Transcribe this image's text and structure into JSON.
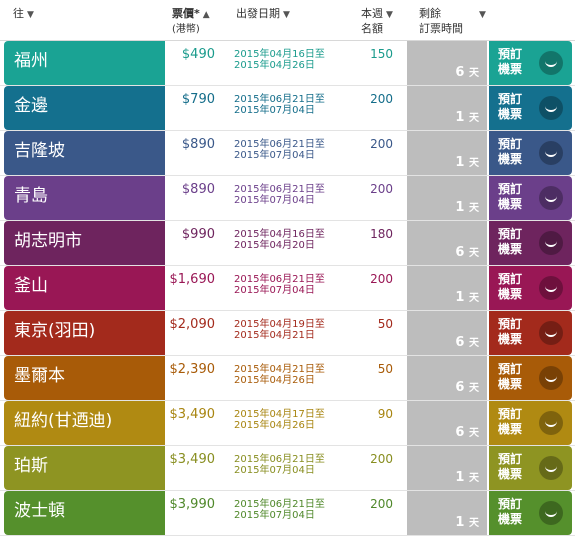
{
  "header": {
    "dest": "往",
    "price_line1": "票價*",
    "price_line2": "(港幣)",
    "price_sort": "▲",
    "date": "出發日期",
    "quota_line1": "本週",
    "quota_line2": "名額",
    "remain_line1": "剩餘",
    "remain_line2": "訂票時間",
    "sort_arrow": "▼"
  },
  "book_label_line1": "預訂",
  "book_label_line2": "機票",
  "days_unit": "天",
  "rows": [
    {
      "dest": "福州",
      "price": "$490",
      "date1": "2015年04月16日至",
      "date2": "2015年04月26日",
      "quota": "150",
      "days": "6",
      "color": "#1aa394",
      "text": "#1a9b8c"
    },
    {
      "dest": "金邊",
      "price": "$790",
      "date1": "2015年06月21日至",
      "date2": "2015年07月04日",
      "quota": "200",
      "days": "1",
      "color": "#14708e",
      "text": "#146d8a"
    },
    {
      "dest": "吉隆坡",
      "price": "$890",
      "date1": "2015年06月21日至",
      "date2": "2015年07月04日",
      "quota": "200",
      "days": "1",
      "color": "#3a5889",
      "text": "#3a5889"
    },
    {
      "dest": "青島",
      "price": "$890",
      "date1": "2015年06月21日至",
      "date2": "2015年07月04日",
      "quota": "200",
      "days": "1",
      "color": "#6b3f8a",
      "text": "#6b3f8a"
    },
    {
      "dest": "胡志明市",
      "price": "$990",
      "date1": "2015年04月16日至",
      "date2": "2015年04月20日",
      "quota": "180",
      "days": "6",
      "color": "#6e245e",
      "text": "#6e245e"
    },
    {
      "dest": "釜山",
      "price": "$1,690",
      "date1": "2015年06月21日至",
      "date2": "2015年07月04日",
      "quota": "200",
      "days": "1",
      "color": "#991755",
      "text": "#991755"
    },
    {
      "dest": "東京(羽田)",
      "price": "$2,090",
      "date1": "2015年04月19日至",
      "date2": "2015年04月21日",
      "quota": "50",
      "days": "6",
      "color": "#a32a1c",
      "text": "#a32a1c"
    },
    {
      "dest": "墨爾本",
      "price": "$2,390",
      "date1": "2015年04月21日至",
      "date2": "2015年04月26日",
      "quota": "50",
      "days": "6",
      "color": "#a85b08",
      "text": "#a85b08"
    },
    {
      "dest": "紐約(甘迺迪)",
      "price": "$3,490",
      "date1": "2015年04月17日至",
      "date2": "2015年04月26日",
      "quota": "90",
      "days": "6",
      "color": "#b08a12",
      "text": "#a88510"
    },
    {
      "dest": "珀斯",
      "price": "$3,490",
      "date1": "2015年06月21日至",
      "date2": "2015年07月04日",
      "quota": "200",
      "days": "1",
      "color": "#8e9422",
      "text": "#888e20"
    },
    {
      "dest": "波士頓",
      "price": "$3,990",
      "date1": "2015年06月21日至",
      "date2": "2015年07月04日",
      "quota": "200",
      "days": "1",
      "color": "#55902c",
      "text": "#4f882a"
    }
  ]
}
